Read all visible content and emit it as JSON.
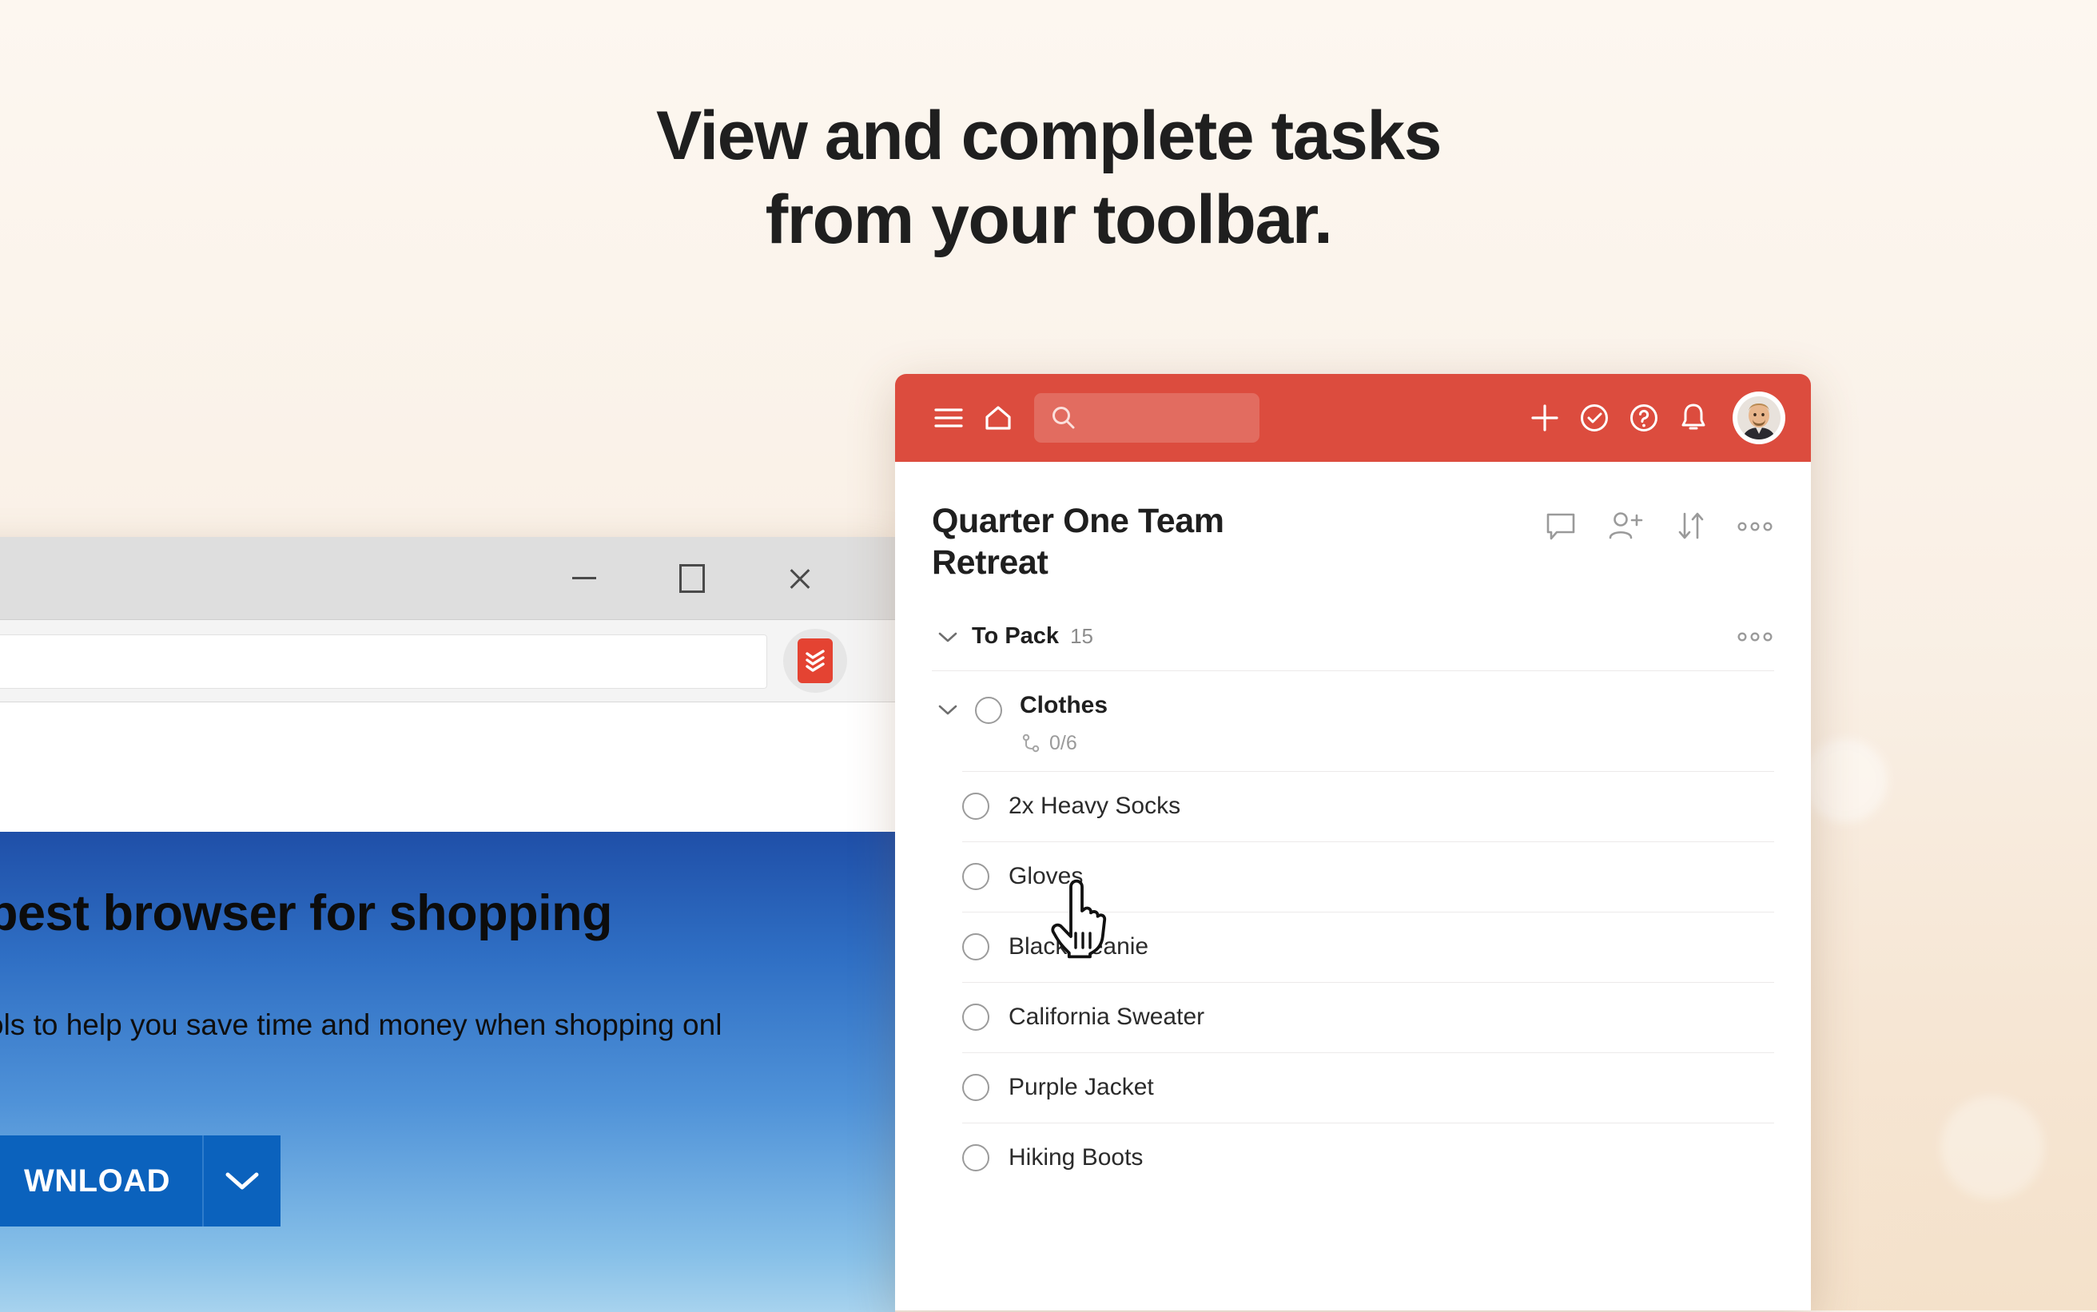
{
  "headline": {
    "line1": "View and complete tasks",
    "line2": "from your toolbar."
  },
  "browser_window": {
    "controls": {
      "minimize": "minimize-button",
      "maximize": "maximize-button",
      "close": "close-button"
    },
    "address_bar": {
      "value": "",
      "placeholder": ""
    },
    "extension": {
      "name": "Todoist",
      "icon": "todoist-logo-icon",
      "color": "#e44332"
    },
    "promo": {
      "headline": "best browser for shopping",
      "subtext": "ols to help you save time and money when shopping onl",
      "download_label": "WNLOAD",
      "caret_icon": "chevron-down-icon",
      "button_color": "#0b62bd"
    }
  },
  "todoist": {
    "accent_color": "#dc4c3e",
    "header": {
      "menu_icon": "hamburger-menu-icon",
      "home_icon": "home-icon",
      "search": {
        "placeholder": "",
        "value": "",
        "icon": "search-icon"
      },
      "add_icon": "plus-icon",
      "productivity_icon": "check-circle-icon",
      "help_icon": "question-circle-icon",
      "notifications_icon": "bell-icon",
      "avatar": "user-avatar"
    },
    "project": {
      "title": "Quarter One Team Retreat",
      "actions": [
        {
          "name": "comments-button",
          "icon": "comment-bubble-icon"
        },
        {
          "name": "add-person-button",
          "icon": "person-plus-icon"
        },
        {
          "name": "sort-button",
          "icon": "sort-arrows-icon"
        },
        {
          "name": "project-more-button",
          "icon": "more-horizontal-icon"
        }
      ]
    },
    "section": {
      "collapse_icon": "chevron-down-icon",
      "name": "To Pack",
      "count": "15",
      "more_icon": "more-horizontal-icon"
    },
    "parent_task": {
      "collapse_icon": "chevron-down-icon",
      "checkbox": "task-checkbox",
      "name": "Clothes",
      "subtask_icon": "subtask-branch-icon",
      "subtask_count": "0/6"
    },
    "subtasks": [
      {
        "name": "2x Heavy Socks"
      },
      {
        "name": "Gloves"
      },
      {
        "name": "Black Beanie"
      },
      {
        "name": "California Sweater"
      },
      {
        "name": "Purple Jacket"
      },
      {
        "name": "Hiking Boots"
      }
    ]
  },
  "cursor": {
    "type": "pointing-hand-cursor"
  }
}
